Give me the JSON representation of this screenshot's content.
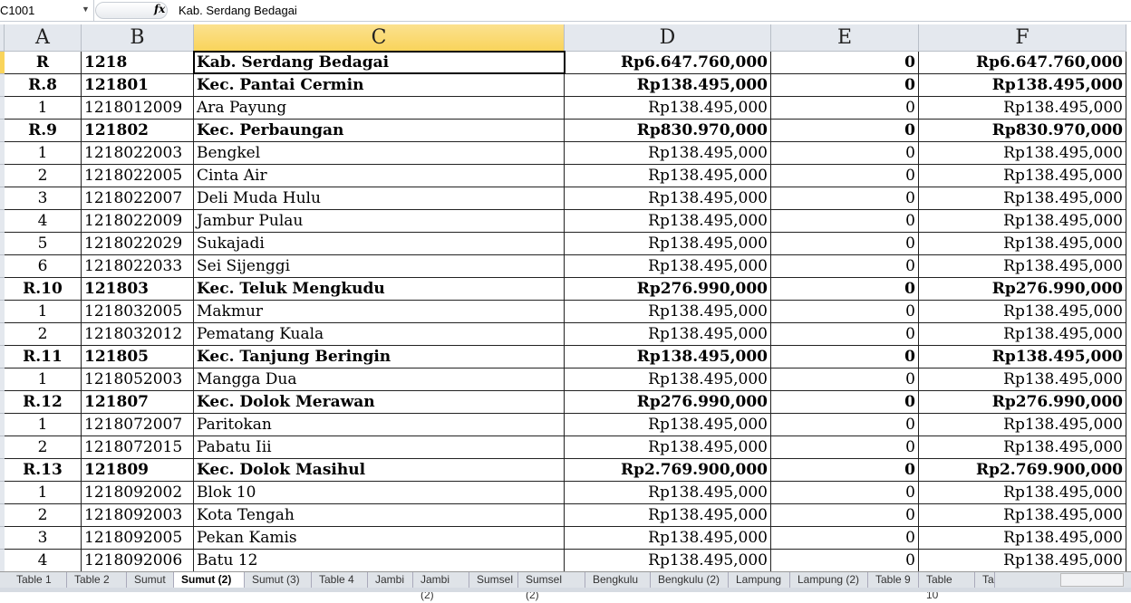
{
  "formula_bar": {
    "name_box": "C1001",
    "fx_label": "fx",
    "value": "Kab. Serdang Bedagai"
  },
  "columns": [
    "A",
    "B",
    "C",
    "D",
    "E",
    "F"
  ],
  "selected_column": "C",
  "rows": [
    {
      "bold": true,
      "a": "R",
      "b": "1218",
      "c": "Kab. Serdang Bedagai",
      "d": "Rp6.647.760,000",
      "e": "0",
      "f": "Rp6.647.760,000"
    },
    {
      "bold": true,
      "a": "R.8",
      "b": "121801",
      "c": "Kec. Pantai Cermin",
      "d": "Rp138.495,000",
      "e": "0",
      "f": "Rp138.495,000"
    },
    {
      "bold": false,
      "a": "1",
      "b": "1218012009",
      "c": "Ara Payung",
      "d": "Rp138.495,000",
      "e": "0",
      "f": "Rp138.495,000"
    },
    {
      "bold": true,
      "a": "R.9",
      "b": "121802",
      "c": "Kec. Perbaungan",
      "d": "Rp830.970,000",
      "e": "0",
      "f": "Rp830.970,000"
    },
    {
      "bold": false,
      "a": "1",
      "b": "1218022003",
      "c": "Bengkel",
      "d": "Rp138.495,000",
      "e": "0",
      "f": "Rp138.495,000"
    },
    {
      "bold": false,
      "a": "2",
      "b": "1218022005",
      "c": "Cinta Air",
      "d": "Rp138.495,000",
      "e": "0",
      "f": "Rp138.495,000"
    },
    {
      "bold": false,
      "a": "3",
      "b": "1218022007",
      "c": "Deli Muda Hulu",
      "d": "Rp138.495,000",
      "e": "0",
      "f": "Rp138.495,000"
    },
    {
      "bold": false,
      "a": "4",
      "b": "1218022009",
      "c": "Jambur Pulau",
      "d": "Rp138.495,000",
      "e": "0",
      "f": "Rp138.495,000"
    },
    {
      "bold": false,
      "a": "5",
      "b": "1218022029",
      "c": "Sukajadi",
      "d": "Rp138.495,000",
      "e": "0",
      "f": "Rp138.495,000"
    },
    {
      "bold": false,
      "a": "6",
      "b": "1218022033",
      "c": "Sei Sijenggi",
      "d": "Rp138.495,000",
      "e": "0",
      "f": "Rp138.495,000"
    },
    {
      "bold": true,
      "a": "R.10",
      "b": "121803",
      "c": "Kec. Teluk Mengkudu",
      "d": "Rp276.990,000",
      "e": "0",
      "f": "Rp276.990,000"
    },
    {
      "bold": false,
      "a": "1",
      "b": "1218032005",
      "c": "Makmur",
      "d": "Rp138.495,000",
      "e": "0",
      "f": "Rp138.495,000"
    },
    {
      "bold": false,
      "a": "2",
      "b": "1218032012",
      "c": "Pematang Kuala",
      "d": "Rp138.495,000",
      "e": "0",
      "f": "Rp138.495,000"
    },
    {
      "bold": true,
      "a": "R.11",
      "b": "121805",
      "c": "Kec. Tanjung Beringin",
      "d": "Rp138.495,000",
      "e": "0",
      "f": "Rp138.495,000"
    },
    {
      "bold": false,
      "a": "1",
      "b": "1218052003",
      "c": "Mangga Dua",
      "d": "Rp138.495,000",
      "e": "0",
      "f": "Rp138.495,000"
    },
    {
      "bold": true,
      "a": "R.12",
      "b": "121807",
      "c": "Kec. Dolok Merawan",
      "d": "Rp276.990,000",
      "e": "0",
      "f": "Rp276.990,000"
    },
    {
      "bold": false,
      "a": "1",
      "b": "1218072007",
      "c": "Paritokan",
      "d": "Rp138.495,000",
      "e": "0",
      "f": "Rp138.495,000"
    },
    {
      "bold": false,
      "a": "2",
      "b": "1218072015",
      "c": "Pabatu Iii",
      "d": "Rp138.495,000",
      "e": "0",
      "f": "Rp138.495,000"
    },
    {
      "bold": true,
      "a": "R.13",
      "b": "121809",
      "c": "Kec. Dolok Masihul",
      "d": "Rp2.769.900,000",
      "e": "0",
      "f": "Rp2.769.900,000"
    },
    {
      "bold": false,
      "a": "1",
      "b": "1218092002",
      "c": "Blok 10",
      "d": "Rp138.495,000",
      "e": "0",
      "f": "Rp138.495,000"
    },
    {
      "bold": false,
      "a": "2",
      "b": "1218092003",
      "c": "Kota Tengah",
      "d": "Rp138.495,000",
      "e": "0",
      "f": "Rp138.495,000"
    },
    {
      "bold": false,
      "a": "3",
      "b": "1218092005",
      "c": "Pekan Kamis",
      "d": "Rp138.495,000",
      "e": "0",
      "f": "Rp138.495,000"
    },
    {
      "bold": false,
      "a": "4",
      "b": "1218092006",
      "c": "Batu 12",
      "d": "Rp138.495,000",
      "e": "0",
      "f": "Rp138.495,000"
    }
  ],
  "sheet_tabs": [
    "Table 1",
    "Table 2",
    "Sumut",
    "Sumut (2)",
    "Sumut (3)",
    "Table 4",
    "Jambi",
    "Jambi (2)",
    "Sumsel",
    "Sumsel (2)",
    "Bengkulu",
    "Bengkulu (2)",
    "Lampung",
    "Lampung (2)",
    "Table 9",
    "Table 10",
    "Ta"
  ],
  "active_tab": "Sumut (2)"
}
